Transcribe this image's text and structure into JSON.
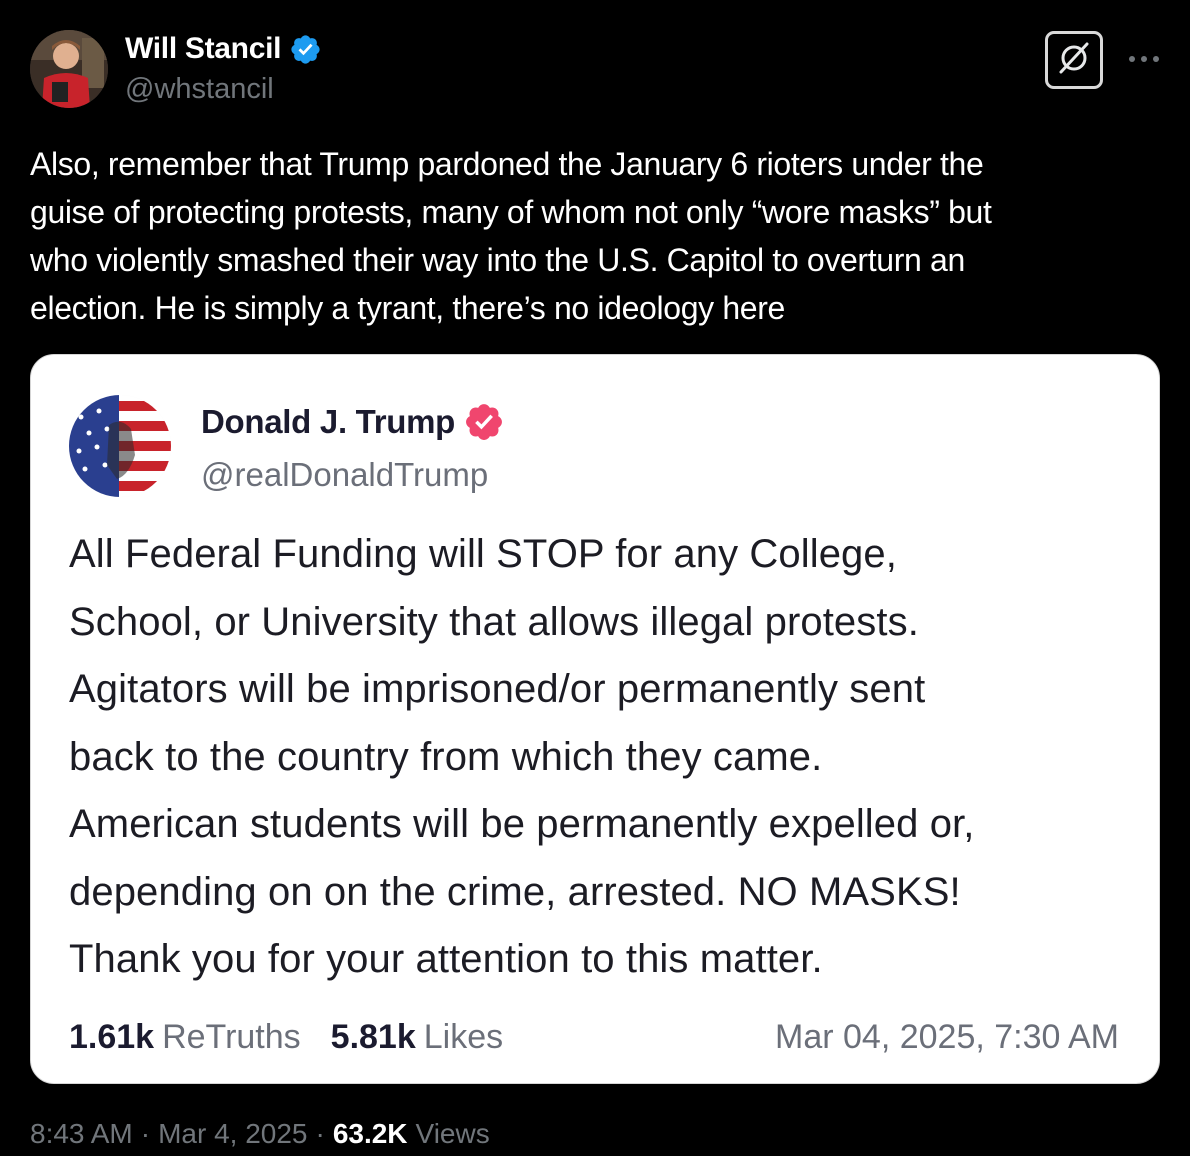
{
  "author": {
    "name": "Will Stancil",
    "handle": "@whstancil",
    "verified_color": "#1d9bf0"
  },
  "tweet_text": "Also, remember that Trump pardoned the January 6 rioters under the\nguise of protecting protests, many of whom not only “wore masks” but\nwho violently smashed their way into the U.S. Capitol to overturn an\nelection. He is simply a tyrant, there’s no ideology here",
  "icons": {
    "grok": "grok-icon",
    "more": "more-horizontal-icon",
    "verified": "verified-badge-icon"
  },
  "embedded_post": {
    "author_name": "Donald J. Trump",
    "author_handle": "@realDonaldTrump",
    "verified_color": "#f0466e",
    "body": "All Federal Funding will STOP for any College,\nSchool, or University that allows illegal protests.\nAgitators will be imprisoned/or permanently sent\nback to the country from which they came.\nAmerican students will be permanently expelled or,\ndepending on on the crime, arrested. NO MASKS!\nThank you for your attention to this matter.",
    "retruths_count": "1.61k",
    "retruths_label": "ReTruths",
    "likes_count": "5.81k",
    "likes_label": "Likes",
    "date": "Mar 04, 2025, 7:30 AM"
  },
  "meta": {
    "time": "8:43 AM",
    "separator": "·",
    "date": "Mar 4, 2025",
    "views_count": "63.2K",
    "views_label": "Views"
  }
}
